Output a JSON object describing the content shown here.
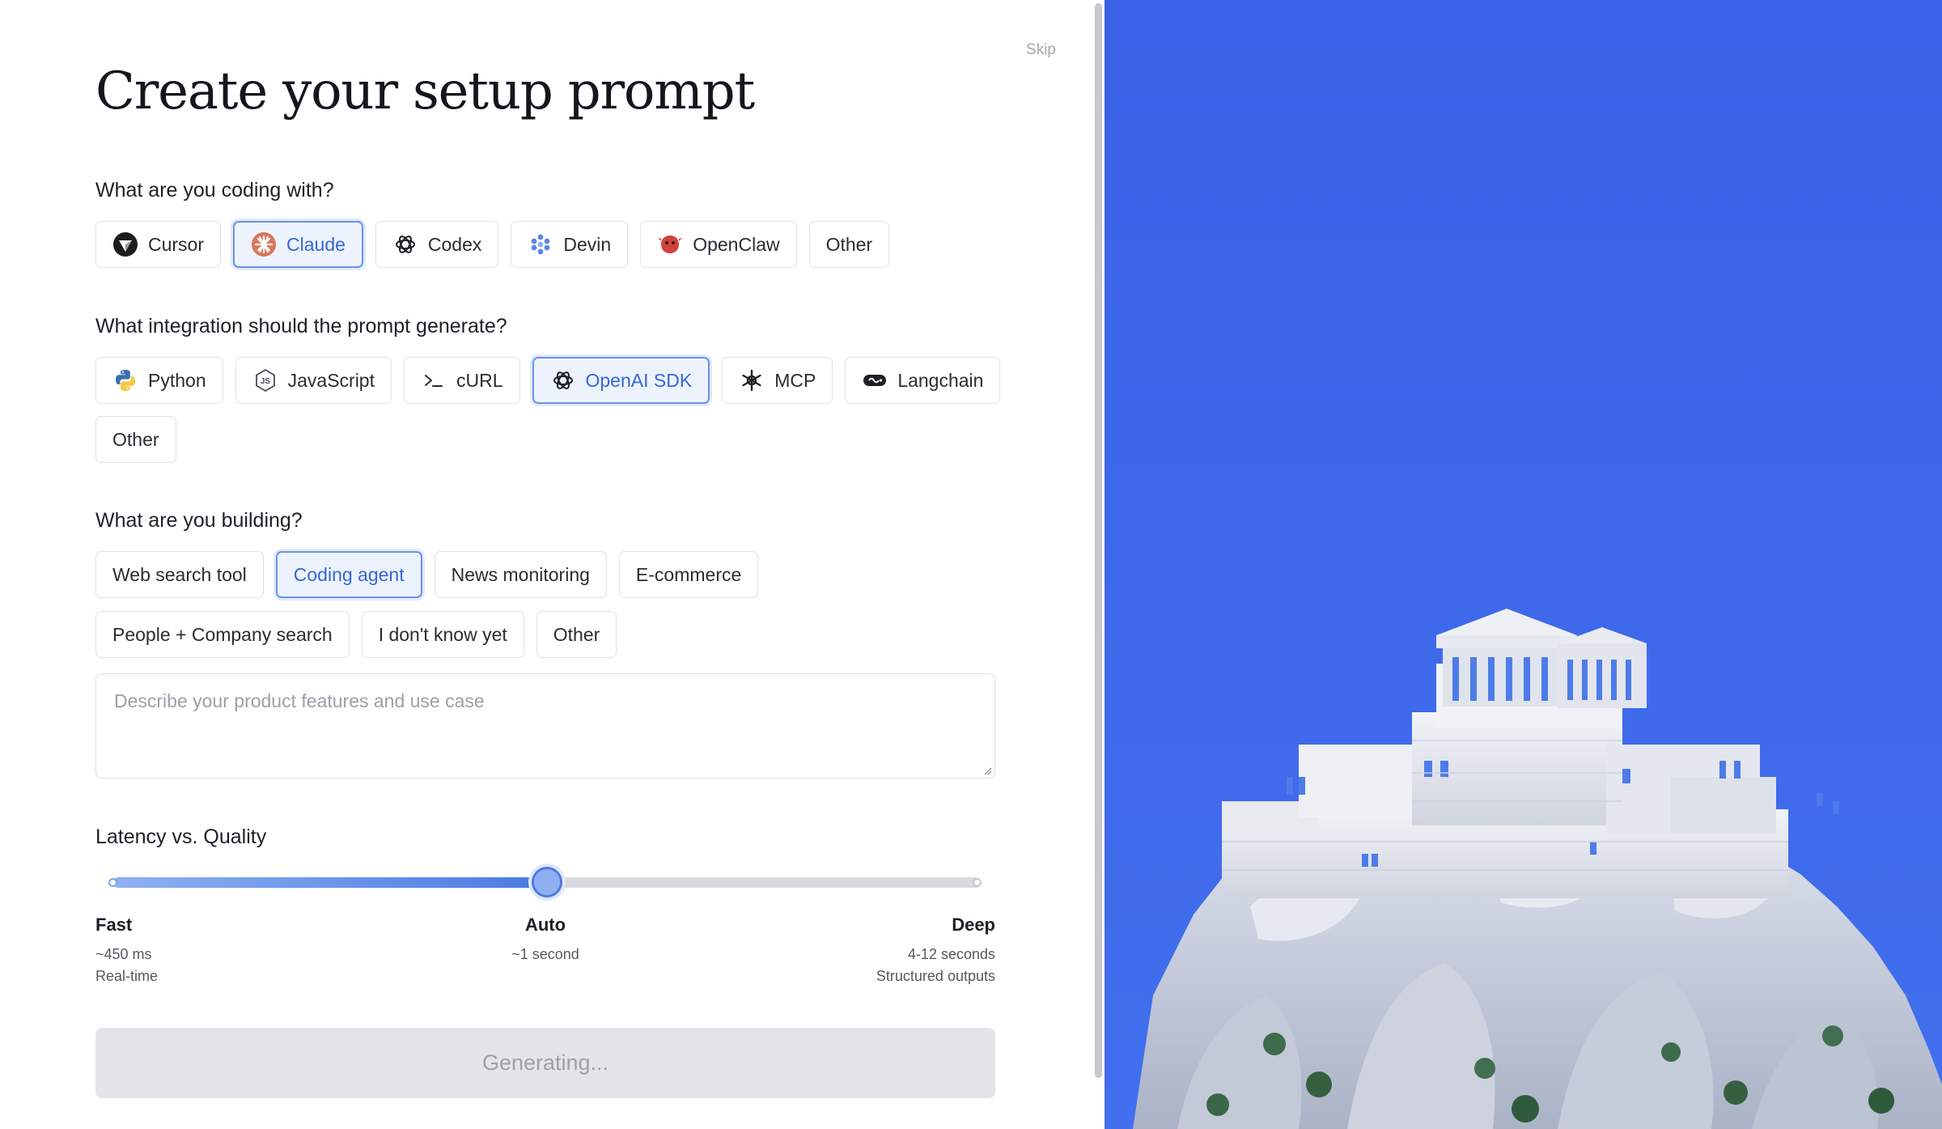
{
  "skip_label": "Skip",
  "title": "Create your setup prompt",
  "coding": {
    "question": "What are you coding with?",
    "options": [
      {
        "label": "Cursor",
        "icon": "cursor-icon",
        "selected": false
      },
      {
        "label": "Claude",
        "icon": "claude-icon",
        "selected": true
      },
      {
        "label": "Codex",
        "icon": "openai-icon",
        "selected": false
      },
      {
        "label": "Devin",
        "icon": "devin-icon",
        "selected": false
      },
      {
        "label": "OpenClaw",
        "icon": "openclaw-icon",
        "selected": false
      },
      {
        "label": "Other",
        "icon": null,
        "selected": false
      }
    ]
  },
  "integration": {
    "question": "What integration should the prompt generate?",
    "options": [
      {
        "label": "Python",
        "icon": "python-icon",
        "selected": false
      },
      {
        "label": "JavaScript",
        "icon": "nodejs-icon",
        "selected": false
      },
      {
        "label": "cURL",
        "icon": "terminal-icon",
        "selected": false
      },
      {
        "label": "OpenAI SDK",
        "icon": "openai-icon",
        "selected": true
      },
      {
        "label": "MCP",
        "icon": "mcp-icon",
        "selected": false
      },
      {
        "label": "Langchain",
        "icon": "langchain-icon",
        "selected": false
      },
      {
        "label": "Other",
        "icon": null,
        "selected": false
      }
    ]
  },
  "building": {
    "question": "What are you building?",
    "options": [
      {
        "label": "Web search tool",
        "selected": false
      },
      {
        "label": "Coding agent",
        "selected": true
      },
      {
        "label": "News monitoring",
        "selected": false
      },
      {
        "label": "E-commerce",
        "selected": false
      },
      {
        "label": "People + Company search",
        "selected": false
      },
      {
        "label": "I don't know yet",
        "selected": false
      },
      {
        "label": "Other",
        "selected": false
      }
    ],
    "description_placeholder": "Describe your product features and use case",
    "description_value": ""
  },
  "latency": {
    "label": "Latency vs. Quality",
    "value": 0.5,
    "fast": {
      "name": "Fast",
      "line1": "~450 ms",
      "line2": "Real-time"
    },
    "auto": {
      "name": "Auto",
      "line1": "~1 second"
    },
    "deep": {
      "name": "Deep",
      "line1": "4-12 seconds",
      "line2": "Structured outputs"
    }
  },
  "generate_label": "Generating...",
  "colors": {
    "accent": "#4a7be3",
    "selected_bg": "#edf3fd",
    "hero_sky": "#3b67ea"
  }
}
